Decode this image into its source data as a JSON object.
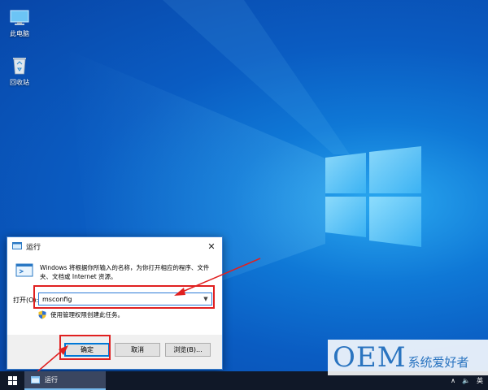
{
  "desktop": {
    "icons": [
      {
        "label": "此电脑",
        "icon": "this-pc-icon"
      },
      {
        "label": "回收站",
        "icon": "recycle-bin-icon"
      }
    ]
  },
  "run_dialog": {
    "title": "运行",
    "description": "Windows 将根据你所输入的名称，为你打开相应的程序、文件夹、文档或 Internet 资源。",
    "open_label": "打开(O):",
    "open_value": "msconfig",
    "admin_note": "使用管理权限创建此任务。",
    "buttons": {
      "ok": "确定",
      "cancel": "取消",
      "browse": "浏览(B)..."
    }
  },
  "taskbar": {
    "active_item": "运行",
    "tray": {
      "ime": "英"
    }
  },
  "watermark": {
    "brand": "OEM",
    "text": "系统爱好者"
  },
  "colors": {
    "accent": "#0078d7",
    "annotation": "#e02020",
    "taskbar": "#101828"
  }
}
